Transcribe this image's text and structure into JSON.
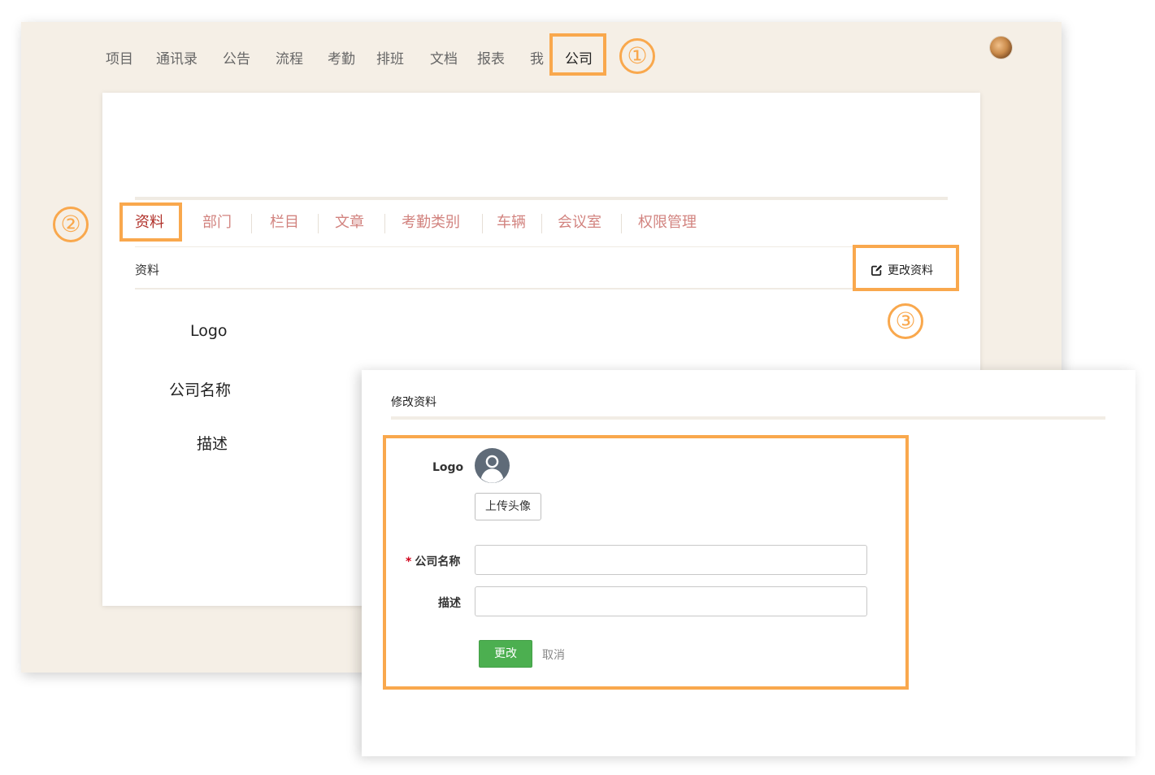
{
  "topnav": {
    "items": [
      "项目",
      "通讯录",
      "公告",
      "流程",
      "考勤",
      "排班",
      "文档",
      "报表",
      "我",
      "公司"
    ],
    "active_index": 9
  },
  "tabs": {
    "items": [
      "资料",
      "部门",
      "栏目",
      "文章",
      "考勤类别",
      "车辆",
      "会议室",
      "权限管理"
    ],
    "active_index": 0
  },
  "profile_section": {
    "title": "资料",
    "edit_label": "更改资料",
    "fields": [
      "Logo",
      "公司名称",
      "描述"
    ]
  },
  "annotations": [
    "①",
    "②",
    "③"
  ],
  "modal": {
    "title": "修改资料",
    "logo_label": "Logo",
    "upload_label": "上传头像",
    "company_name_label": "公司名称",
    "required_mark": "*",
    "description_label": "描述",
    "company_name_value": "",
    "description_value": "",
    "submit_label": "更改",
    "cancel_label": "取消"
  },
  "colors": {
    "annotation": "#f9a84d",
    "background": "#f5efe6",
    "tab_text": "#d2837f",
    "tab_active": "#b03029",
    "submit": "#4caf50",
    "required": "#d0021b"
  },
  "icons": {
    "edit": "edit-icon",
    "default_avatar": "user-avatar-icon",
    "user_avatar": "user-photo"
  }
}
